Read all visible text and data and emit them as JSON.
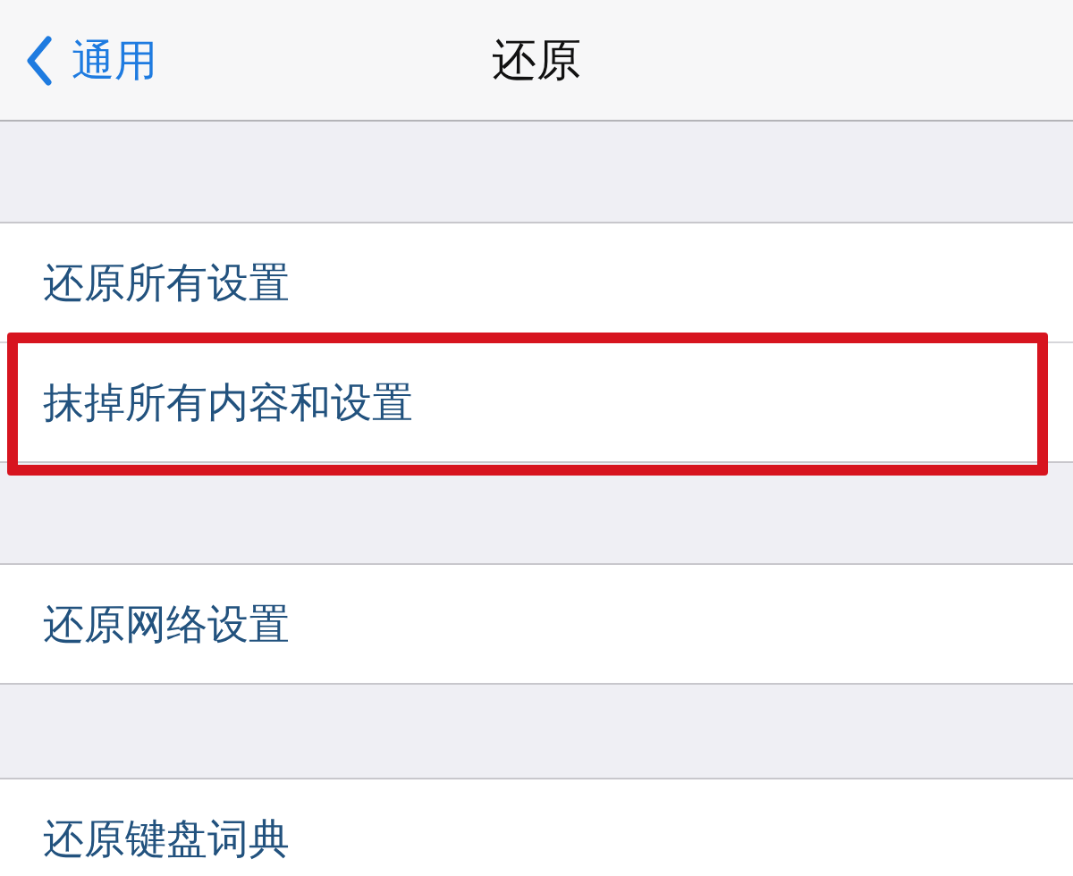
{
  "nav": {
    "back": "通用",
    "title": "还原"
  },
  "groups": [
    [
      {
        "label": "还原所有设置",
        "highlighted": false
      },
      {
        "label": "抹掉所有内容和设置",
        "highlighted": true
      }
    ],
    [
      {
        "label": "还原网络设置",
        "highlighted": false
      }
    ],
    [
      {
        "label": "还原键盘词典",
        "highlighted": false
      }
    ]
  ]
}
